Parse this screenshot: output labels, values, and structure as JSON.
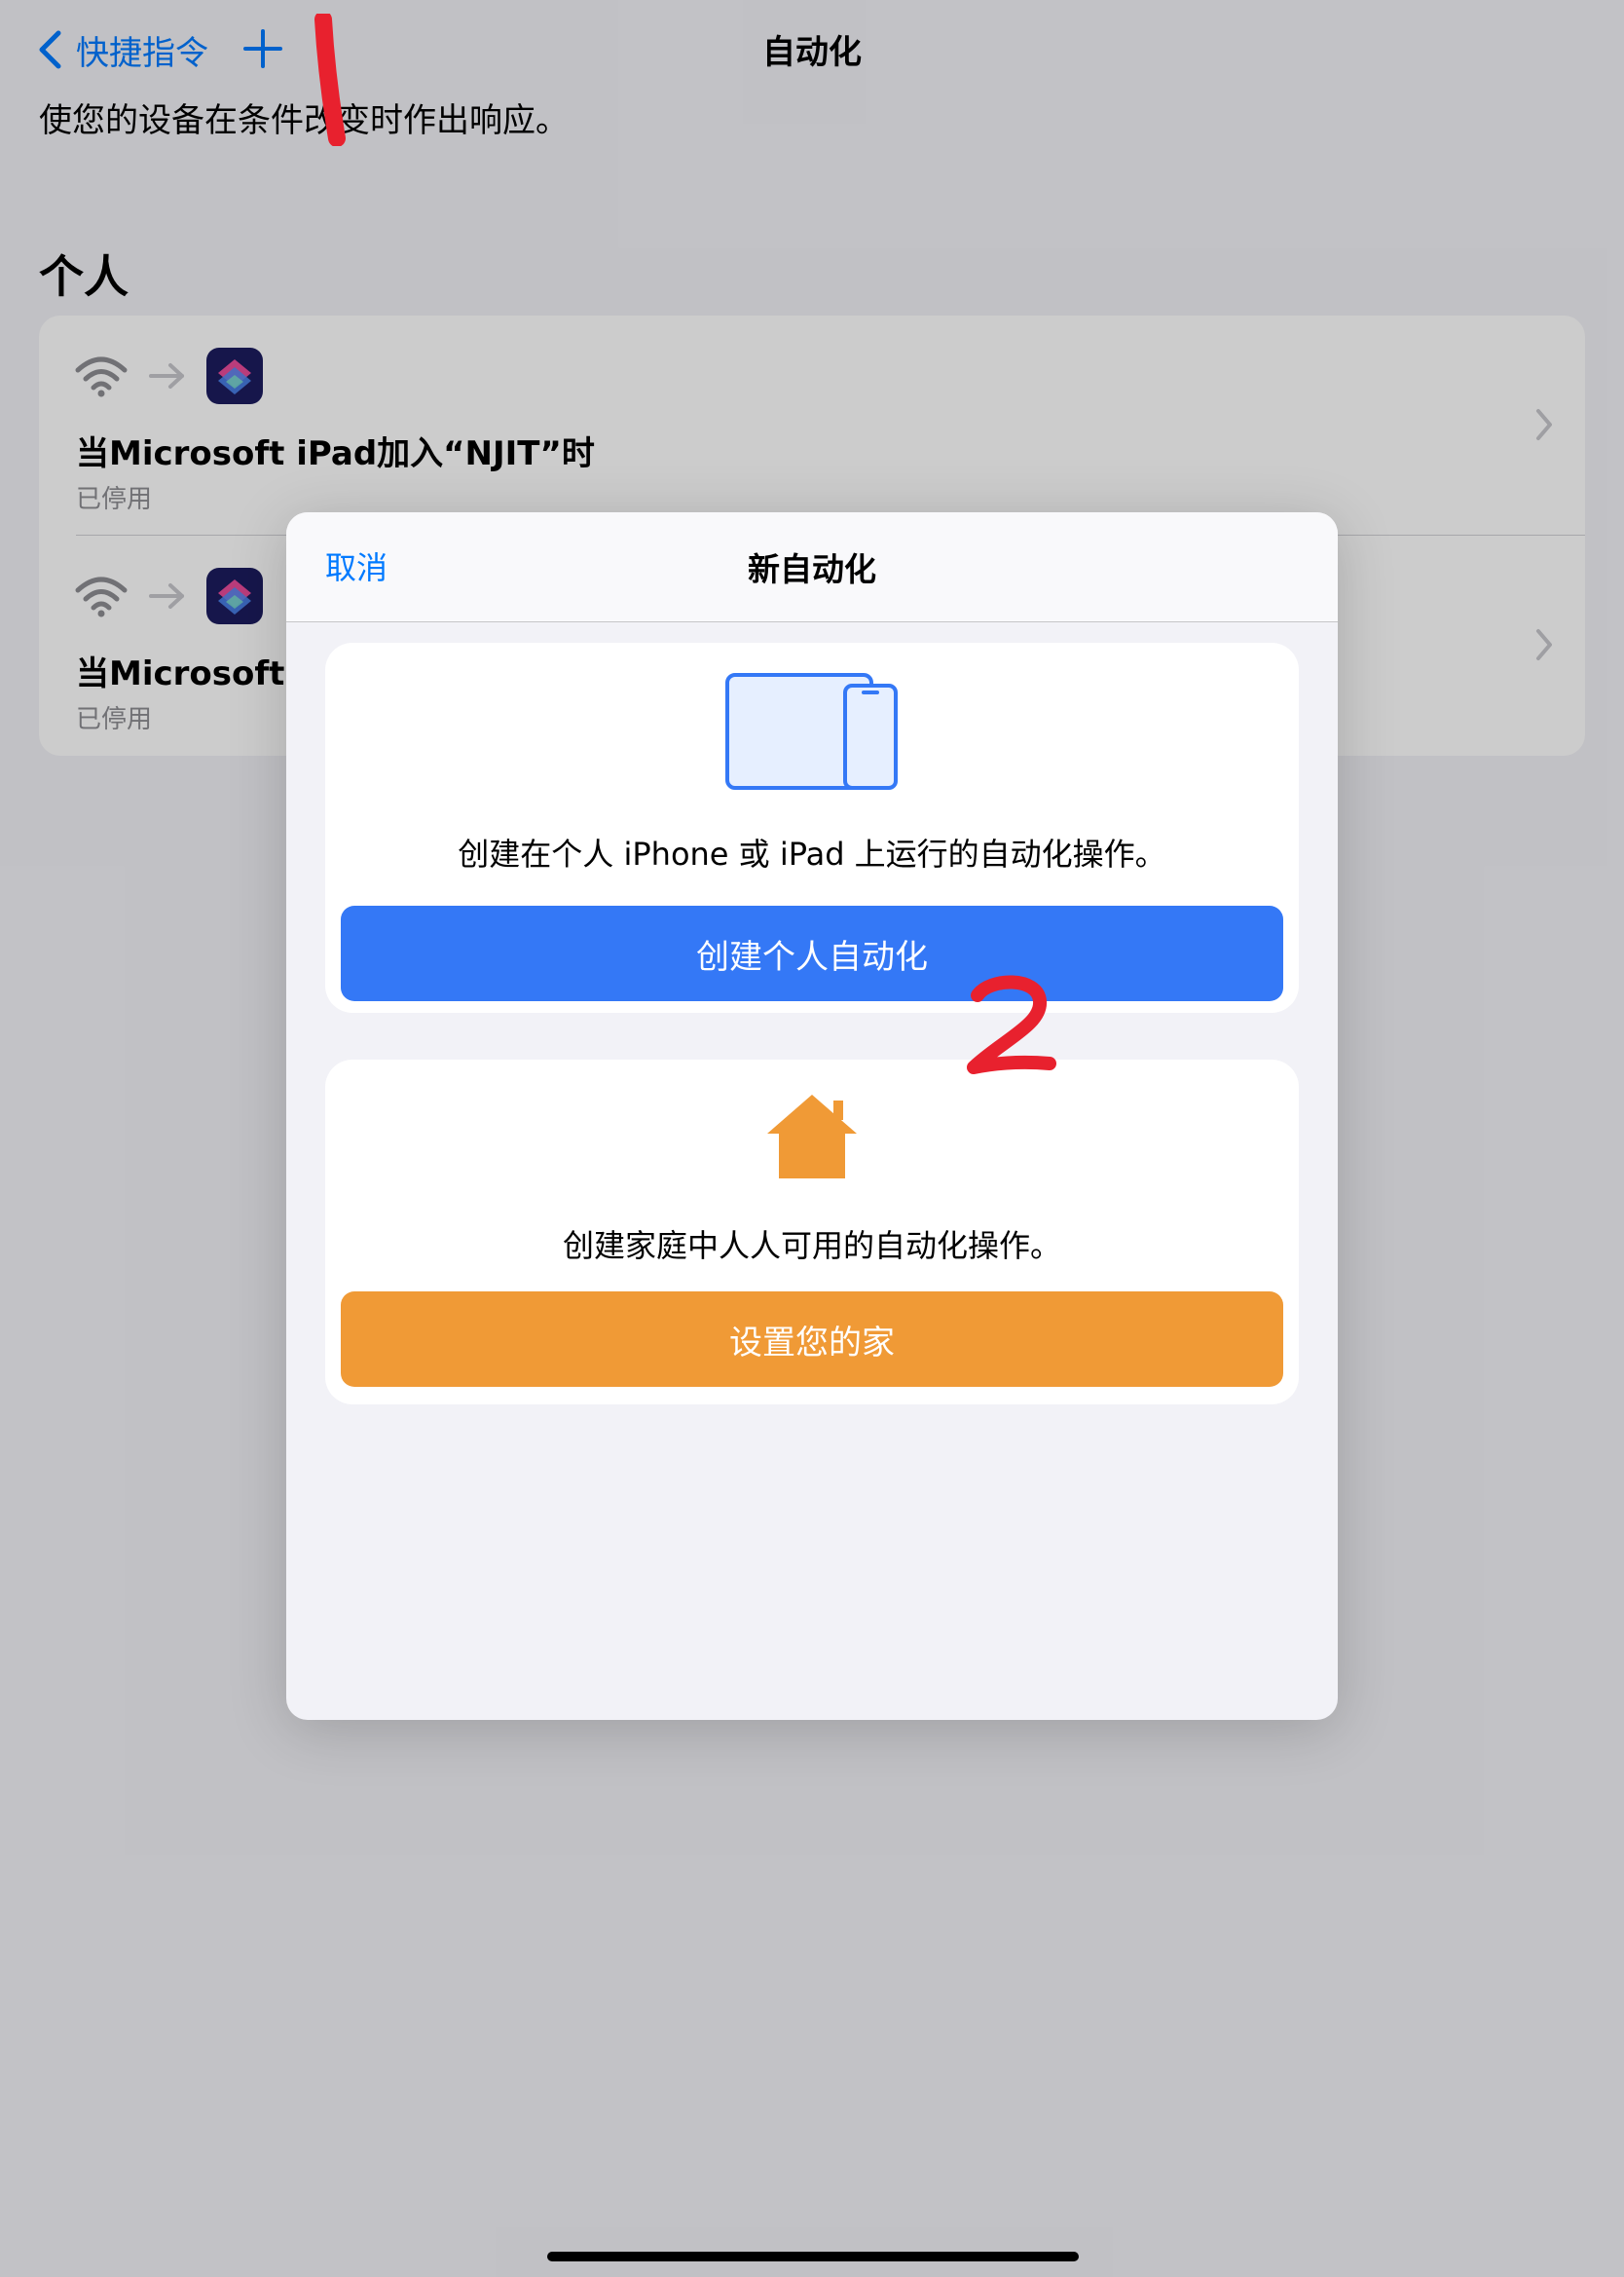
{
  "nav": {
    "back_label": "快捷指令",
    "title": "自动化"
  },
  "subtitle": "使您的设备在条件改变时作出响应。",
  "section_title": "个人",
  "automations": [
    {
      "title": "当Microsoft iPad加入“NJIT”时",
      "status": "已停用"
    },
    {
      "title": "当Microsoft iP",
      "status": "已停用"
    }
  ],
  "modal": {
    "cancel_label": "取消",
    "title": "新自动化",
    "personal": {
      "description": "创建在个人 iPhone 或 iPad 上运行的自动化操作。",
      "button_label": "创建个人自动化",
      "color": "#3478f6",
      "icon": "ipad-iphone-icon"
    },
    "home": {
      "description": "创建家庭中人人可用的自动化操作。",
      "button_label": "设置您的家",
      "color": "#f09a36",
      "icon": "house-icon"
    }
  },
  "annotations": [
    {
      "label": "1",
      "color": "#e8212e"
    },
    {
      "label": "2",
      "color": "#e8212e"
    }
  ],
  "icons": {
    "back": "chevron-left-icon",
    "add": "plus-icon",
    "trigger": "wifi-icon",
    "arrow": "arrow-right-icon",
    "app": "shortcuts-app-icon",
    "disclosure": "chevron-right-icon"
  }
}
